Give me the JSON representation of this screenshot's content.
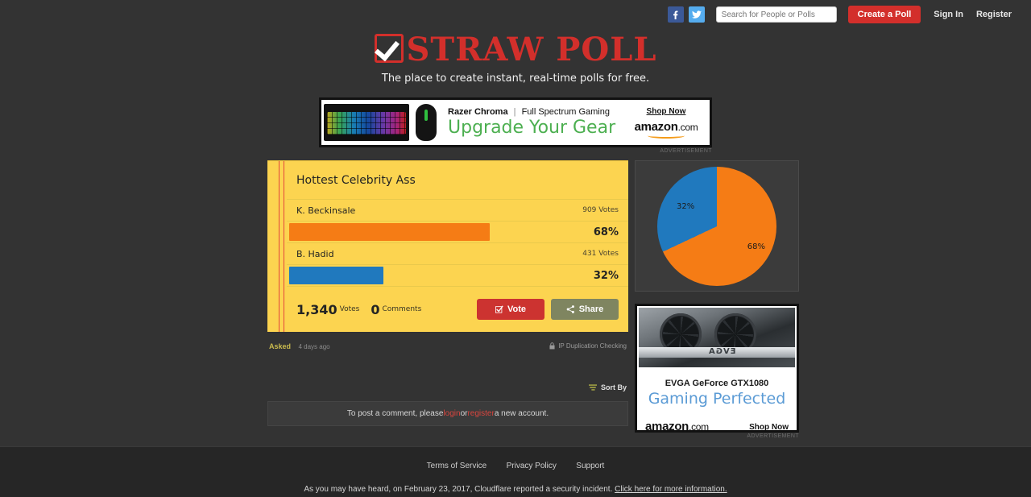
{
  "topbar": {
    "facebook_icon": "facebook-icon",
    "twitter_icon": "twitter-icon",
    "search_placeholder": "Search for People or Polls",
    "search_value": "",
    "create_poll_label": "Create a Poll",
    "sign_in_label": "Sign In",
    "register_label": "Register"
  },
  "brand": {
    "name": "Straw Poll",
    "tagline": "The place to create instant, real-time polls for free.",
    "logo_color": "#d32f2b"
  },
  "banner_ad": {
    "headline_brand": "Razer Chroma",
    "separator": "|",
    "headline_sub": "Full Spectrum Gaming",
    "tagline": "Upgrade Your Gear",
    "cta": "Shop Now",
    "merchant": "amazon",
    "merchant_tld": ".com",
    "label": "ADVERTISEMENT"
  },
  "poll": {
    "title": "Hottest Celebrity Ass",
    "options": [
      {
        "name": "K. Beckinsale",
        "votes_text": "909 Votes",
        "votes": 909,
        "percent_text": "68%",
        "percent": 68,
        "color": "#f57c15"
      },
      {
        "name": "B. Hadid",
        "votes_text": "431 Votes",
        "votes": 431,
        "percent_text": "32%",
        "percent": 32,
        "color": "#2079be"
      }
    ],
    "total_votes": "1,340",
    "total_votes_label": "Votes",
    "comments_count": "0",
    "comments_label": "Comments",
    "vote_label": "Vote",
    "share_label": "Share",
    "asked_label": "Asked",
    "asked_time": "4 days ago",
    "ip_check_label": "IP Duplication Checking"
  },
  "comments": {
    "sort_by_label": "Sort By",
    "prompt_prefix": "To post a comment, please ",
    "login_label": "login",
    "prompt_middle": " or ",
    "register_label": "register",
    "prompt_suffix": " a new account."
  },
  "chart_data": {
    "type": "pie",
    "title": "",
    "labels": [
      "K. Beckinsale",
      "B. Hadid"
    ],
    "values": [
      68,
      32
    ],
    "value_labels": [
      "68%",
      "32%"
    ],
    "colors": [
      "#f57c15",
      "#2079be"
    ],
    "legend": false,
    "start_angle": 0
  },
  "side_ad": {
    "title": "EVGA GeForce GTX1080",
    "subtitle": "Gaming Perfected",
    "merchant": "amazon",
    "merchant_tld": ".com",
    "cta": "Shop Now",
    "gpu_brand": "EVGA",
    "label": "ADVERTISEMENT"
  },
  "footer": {
    "links": [
      "Terms of Service",
      "Privacy Policy",
      "Support"
    ],
    "notice_text": "As you may have heard, on February 23, 2017, Cloudflare reported a security incident. ",
    "notice_link": "Click here for more information."
  }
}
